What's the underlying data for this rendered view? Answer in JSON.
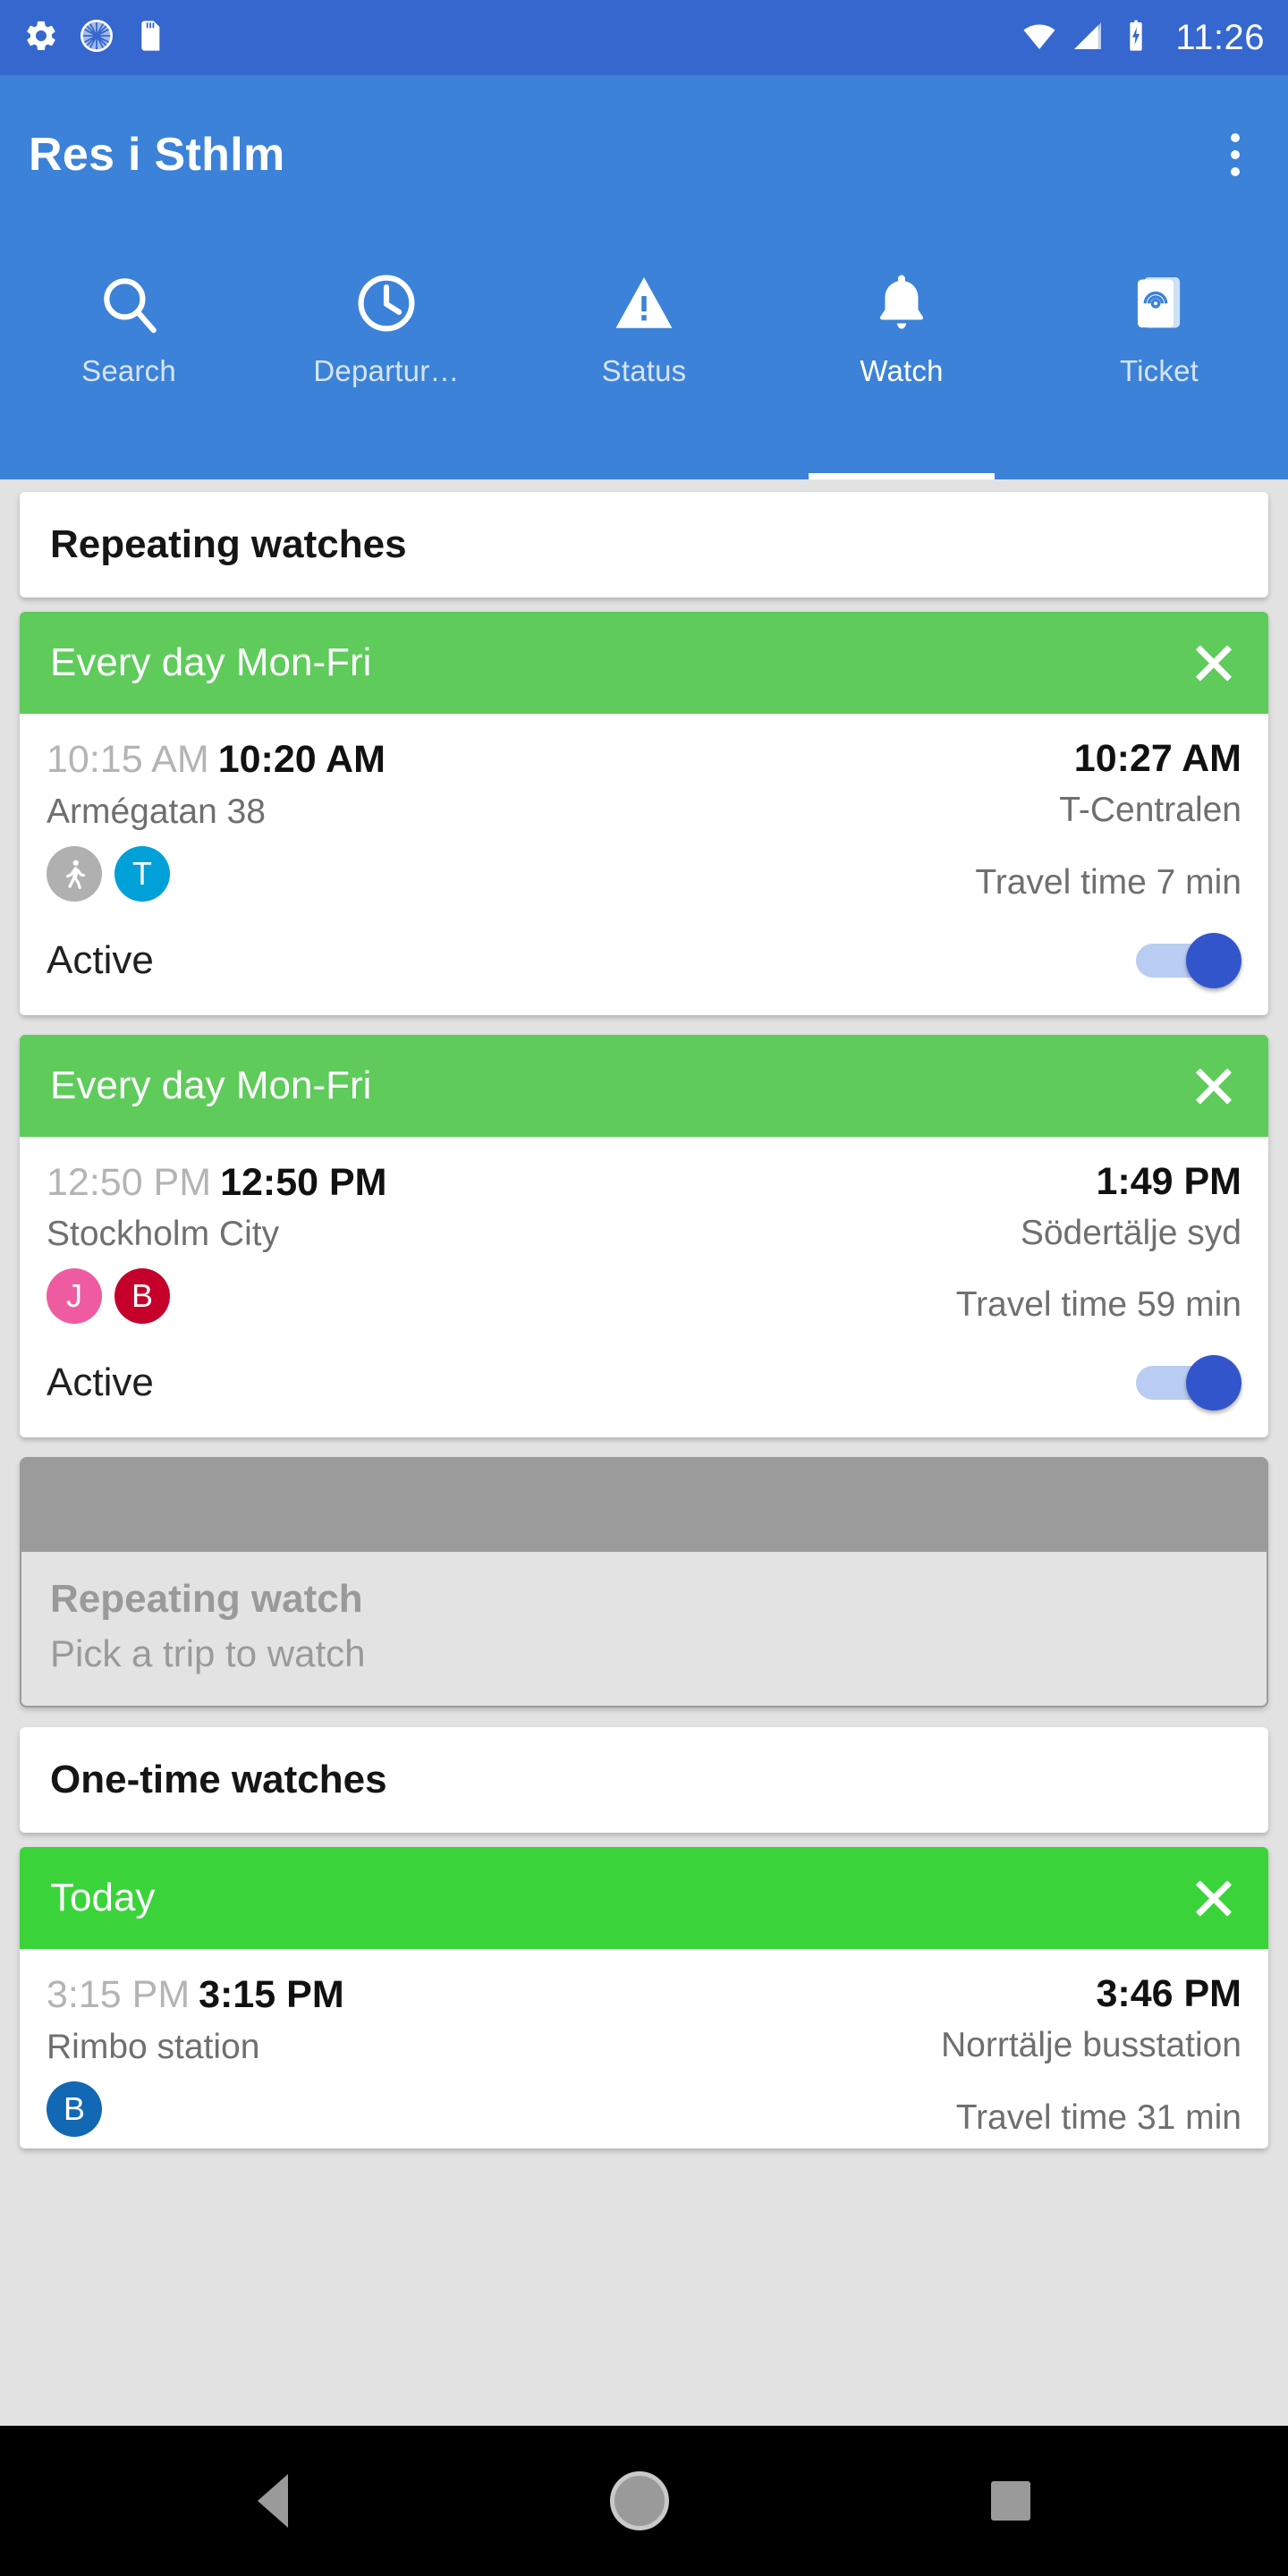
{
  "status_bar": {
    "time": "11:26",
    "left_icons": [
      "settings-gear-icon",
      "sync-spinner-icon",
      "sd-card-icon"
    ],
    "right_icons": [
      "wifi-icon",
      "cell-signal-icon",
      "battery-charging-icon"
    ]
  },
  "app_bar": {
    "title": "Res i Sthlm",
    "overflow_label": "overflow-menu"
  },
  "tabs": [
    {
      "label": "Search",
      "icon": "search-icon",
      "active": false
    },
    {
      "label": "Departur…",
      "icon": "clock-icon",
      "active": false
    },
    {
      "label": "Status",
      "icon": "warning-icon",
      "active": false
    },
    {
      "label": "Watch",
      "icon": "bell-icon",
      "active": true
    },
    {
      "label": "Ticket",
      "icon": "ticket-icon",
      "active": false
    }
  ],
  "sections": {
    "repeating_title": "Repeating watches",
    "onetime_title": "One-time watches"
  },
  "watches": [
    {
      "header": "Every day Mon-Fri",
      "header_color": "#5ecb5b",
      "departure_scheduled": "10:15 AM",
      "departure_actual": "10:20 AM",
      "arrival": "10:27 AM",
      "origin": "Armégatan 38",
      "destination": "T-Centralen",
      "travel_time": "Travel time 7 min",
      "badges": [
        {
          "label": "",
          "type": "walk",
          "color": "#b0b0b0"
        },
        {
          "label": "T",
          "type": "line",
          "color": "#00a0d8"
        }
      ],
      "toggle_label": "Active",
      "toggle_on": true
    },
    {
      "header": "Every day Mon-Fri",
      "header_color": "#5ecb5b",
      "departure_scheduled": "12:50 PM",
      "departure_actual": "12:50 PM",
      "arrival": "1:49 PM",
      "origin": "Stockholm City",
      "destination": "Södertälje syd",
      "travel_time": "Travel time 59 min",
      "badges": [
        {
          "label": "J",
          "type": "line",
          "color": "#ef5ba1"
        },
        {
          "label": "B",
          "type": "line",
          "color": "#c4002b"
        }
      ],
      "toggle_label": "Active",
      "toggle_on": true
    }
  ],
  "placeholder": {
    "title": "Repeating watch",
    "subtitle": "Pick a trip to watch"
  },
  "onetime_watches": [
    {
      "header": "Today",
      "header_color": "#3ad43a",
      "departure_scheduled": "3:15 PM",
      "departure_actual": "3:15 PM",
      "arrival": "3:46 PM",
      "origin": "Rimbo station",
      "destination": "Norrtälje busstation",
      "travel_time": "Travel time 31 min",
      "badges": [
        {
          "label": "B",
          "type": "line",
          "color": "#1268b3"
        }
      ]
    }
  ],
  "nav_bar": {
    "back": "back-button",
    "home": "home-button",
    "recents": "recents-button"
  },
  "colors": {
    "status_bar": "#3567ce",
    "app_bar": "#3b82d8",
    "page_bg": "#e2e2e2",
    "accent_green": "#5ecb5b",
    "toggle_on": "#3355cc"
  }
}
